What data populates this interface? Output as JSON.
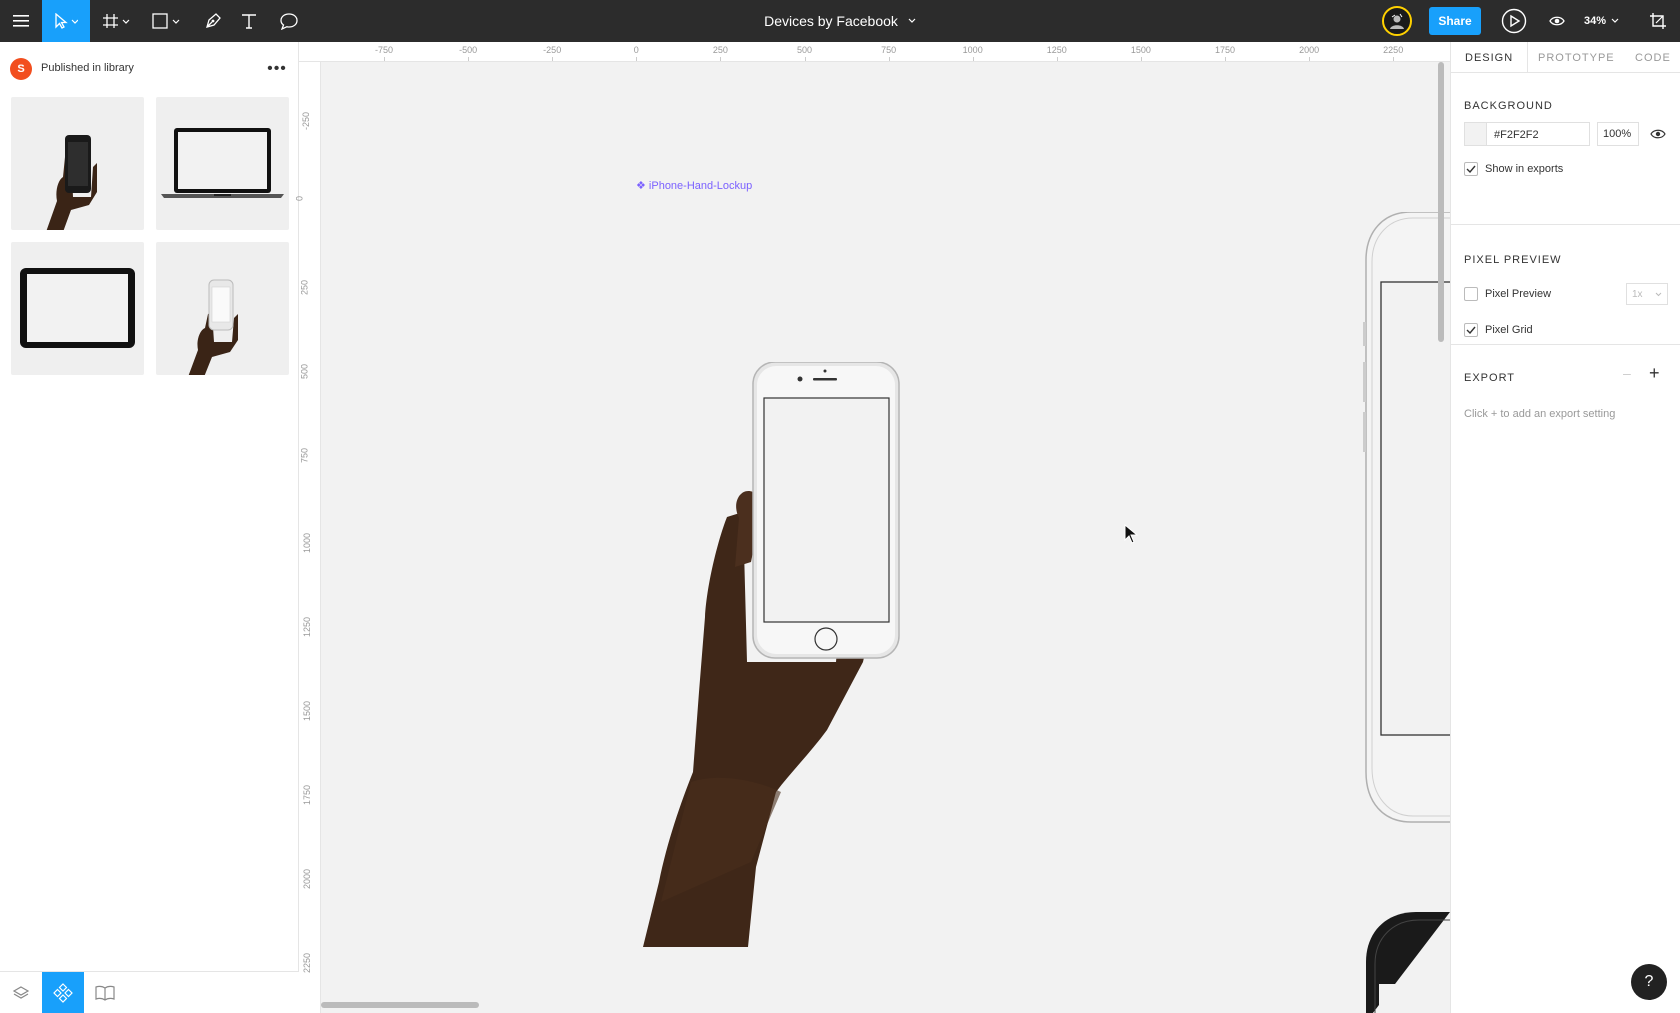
{
  "toolbar": {
    "document_title": "Devices by Facebook",
    "share_label": "Share",
    "zoom_label": "34%"
  },
  "left_panel": {
    "library_badge": "S",
    "library_title": "Published in library",
    "more_label": "•••",
    "thumbnails": [
      "phone-in-hand-dark",
      "laptop",
      "tablet",
      "phone-in-hand-light"
    ]
  },
  "ruler": {
    "top_labels": [
      "-750",
      "-500",
      "-250",
      "0",
      "250",
      "500",
      "750",
      "1000",
      "1250",
      "1500",
      "1750",
      "2000",
      "2250"
    ],
    "left_labels": [
      "-250",
      "0",
      "250",
      "500",
      "750",
      "1000",
      "1250",
      "1500",
      "1750",
      "2000",
      "2250"
    ]
  },
  "canvas": {
    "frame_label": "❖ iPhone-Hand-Lockup",
    "background_color": "#F2F2F2"
  },
  "right_panel": {
    "tabs": [
      "DESIGN",
      "PROTOTYPE",
      "CODE"
    ],
    "background": {
      "title": "BACKGROUND",
      "hex": "#F2F2F2",
      "opacity": "100%",
      "show_in_exports": "Show in exports",
      "show_in_exports_checked": true
    },
    "pixel_preview": {
      "title": "PIXEL PREVIEW",
      "preview_label": "Pixel Preview",
      "preview_checked": false,
      "preview_scale": "1x",
      "grid_label": "Pixel Grid",
      "grid_checked": true
    },
    "export": {
      "title": "EXPORT",
      "hint": "Click + to add an export setting",
      "add_label": "+",
      "remove_label": "–"
    }
  },
  "help_label": "?",
  "colors": {
    "toolbar_bg": "#2c2c2c",
    "accent": "#18a0fb",
    "component_label": "#7b61ff",
    "library_badge": "#f24e1e"
  },
  "icons": [
    "menu-icon",
    "move-tool-icon",
    "frame-tool-icon",
    "shape-tool-icon",
    "pen-tool-icon",
    "text-tool-icon",
    "comment-tool-icon",
    "present-icon",
    "view-icon",
    "layers-icon",
    "components-icon",
    "library-book-icon",
    "eye-icon"
  ]
}
